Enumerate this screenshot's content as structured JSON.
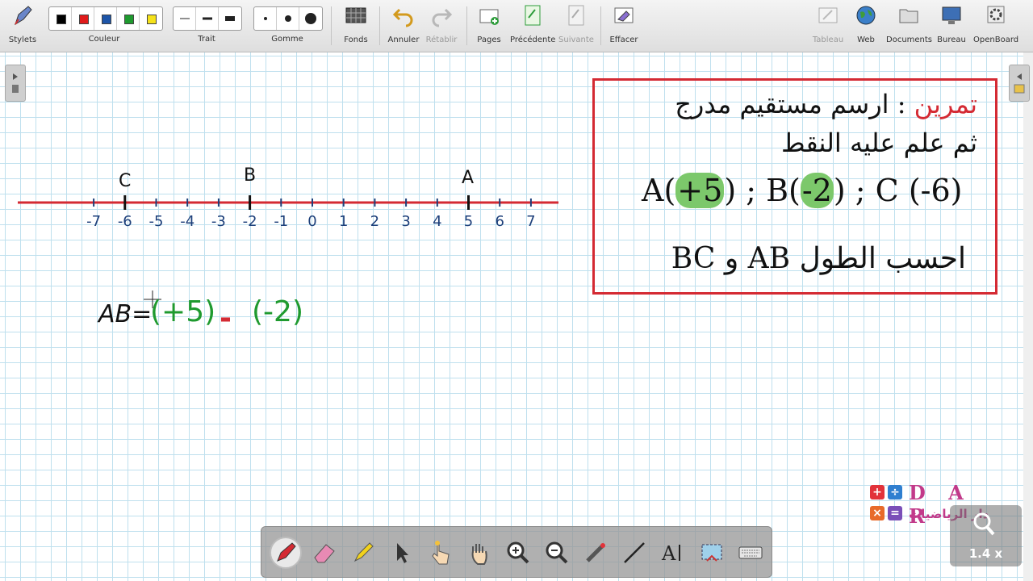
{
  "toolbar": {
    "stylets": "Stylets",
    "couleur": "Couleur",
    "trait": "Trait",
    "gomme": "Gomme",
    "fonds": "Fonds",
    "annuler": "Annuler",
    "retablir": "Rétablir",
    "pages": "Pages",
    "precedente": "Précédente",
    "suivante": "Suivante",
    "effacer": "Effacer",
    "tableau": "Tableau",
    "web": "Web",
    "documents": "Documents",
    "bureau": "Bureau",
    "openboard": "OpenBoard",
    "colors": [
      "#000000",
      "#e01b1b",
      "#1d55a8",
      "#1f9a2f",
      "#f5e21a"
    ]
  },
  "number_line": {
    "ticks": [
      "-7",
      "-6",
      "-5",
      "-4",
      "-3",
      "-2",
      "-1",
      "0",
      "1",
      "2",
      "3",
      "4",
      "5",
      "6",
      "7"
    ],
    "point_c": "C",
    "point_b": "B",
    "point_a": "A"
  },
  "exercise": {
    "title_red": "تمرين",
    "line1_rest": ": ارسم مستقيم مدرج",
    "line2": "ثم علم عليه النقط",
    "a_prefix": "A(",
    "a_value": "+5",
    "a_suffix": ") ; B(",
    "b_value": "-2",
    "b_suffix": ") ; C (-6)",
    "line4": "احسب الطول AB و BC"
  },
  "handwriting": {
    "ab_label": "AB=",
    "term1": "(+5)",
    "minus": "-",
    "term2": "(-2)"
  },
  "logo": {
    "tiles": [
      "+",
      "÷",
      "×",
      "="
    ],
    "letters": "D A R",
    "arabic": "دار الرياضيات"
  },
  "zoom": {
    "label": "1.4 x"
  }
}
